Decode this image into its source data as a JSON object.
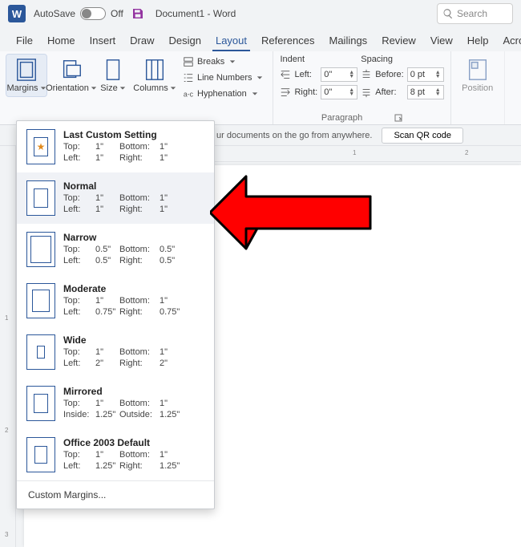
{
  "title": {
    "autosave": "AutoSave",
    "autosave_state": "Off",
    "document": "Document1  -  Word",
    "search_placeholder": "Search"
  },
  "tabs": [
    "File",
    "Home",
    "Insert",
    "Draw",
    "Design",
    "Layout",
    "References",
    "Mailings",
    "Review",
    "View",
    "Help",
    "Acro"
  ],
  "active_tab": 5,
  "page_setup": {
    "margins": "Margins",
    "orientation": "Orientation",
    "size": "Size",
    "columns": "Columns",
    "breaks": "Breaks",
    "line_numbers": "Line Numbers",
    "hyphenation": "Hyphenation"
  },
  "paragraph": {
    "indent_header": "Indent",
    "spacing_header": "Spacing",
    "left_label": "Left:",
    "right_label": "Right:",
    "before_label": "Before:",
    "after_label": "After:",
    "left": "0\"",
    "right": "0\"",
    "before": "0 pt",
    "after": "8 pt",
    "group_label": "Paragraph"
  },
  "arrange": {
    "position": "Position"
  },
  "infobar": {
    "message": "ur documents on the go from anywhere.",
    "qr": "Scan QR code"
  },
  "margins_menu": {
    "options": [
      {
        "name": "Last Custom Setting",
        "top": "1\"",
        "bottom": "1\"",
        "left": "1\"",
        "right": "1\"",
        "l1": "Top:",
        "l2": "Bottom:",
        "l3": "Left:",
        "l4": "Right:",
        "star": true,
        "inner": "8"
      },
      {
        "name": "Normal",
        "top": "1\"",
        "bottom": "1\"",
        "left": "1\"",
        "right": "1\"",
        "l1": "Top:",
        "l2": "Bottom:",
        "l3": "Left:",
        "l4": "Right:",
        "inner": "8"
      },
      {
        "name": "Narrow",
        "top": "0.5\"",
        "bottom": "0.5\"",
        "left": "0.5\"",
        "right": "0.5\"",
        "l1": "Top:",
        "l2": "Bottom:",
        "l3": "Left:",
        "l4": "Right:",
        "inner": "4"
      },
      {
        "name": "Moderate",
        "top": "1\"",
        "bottom": "1\"",
        "left": "0.75\"",
        "right": "0.75\"",
        "l1": "Top:",
        "l2": "Bottom:",
        "l3": "Left:",
        "l4": "Right:",
        "inner": "6"
      },
      {
        "name": "Wide",
        "top": "1\"",
        "bottom": "1\"",
        "left": "2\"",
        "right": "2\"",
        "l1": "Top:",
        "l2": "Bottom:",
        "l3": "Left:",
        "l4": "Right:",
        "inner": "12"
      },
      {
        "name": "Mirrored",
        "top": "1\"",
        "bottom": "1\"",
        "left": "1.25\"",
        "right": "1.25\"",
        "l1": "Top:",
        "l2": "Bottom:",
        "l3": "Inside:",
        "l4": "Outside:",
        "inner": "8"
      },
      {
        "name": "Office 2003 Default",
        "top": "1\"",
        "bottom": "1\"",
        "left": "1.25\"",
        "right": "1.25\"",
        "l1": "Top:",
        "l2": "Bottom:",
        "l3": "Left:",
        "l4": "Right:",
        "inner": "9"
      }
    ],
    "selected": 1,
    "custom": "Custom Margins..."
  },
  "ruler_h": [
    "1",
    "2"
  ],
  "ruler_v": [
    "1",
    "2",
    "3"
  ]
}
